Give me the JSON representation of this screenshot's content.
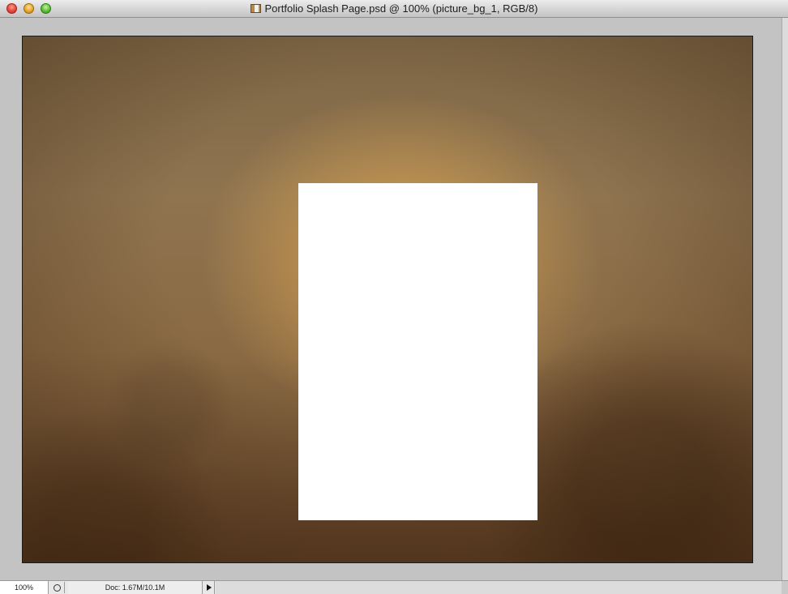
{
  "window": {
    "title": "Portfolio Splash Page.psd @ 100% (picture_bg_1, RGB/8)",
    "file_icon": "photoshop-document-icon",
    "buttons": {
      "close": "close-icon",
      "minimize": "minimize-icon",
      "zoom": "zoom-icon"
    }
  },
  "canvas": {
    "background": "aged-paper-texture",
    "placeholder_color": "#ffffff"
  },
  "statusbar": {
    "zoom_level": "100%",
    "doc_info": "Doc: 1.67M/10.1M",
    "menu_arrow": "play-arrow-icon"
  }
}
